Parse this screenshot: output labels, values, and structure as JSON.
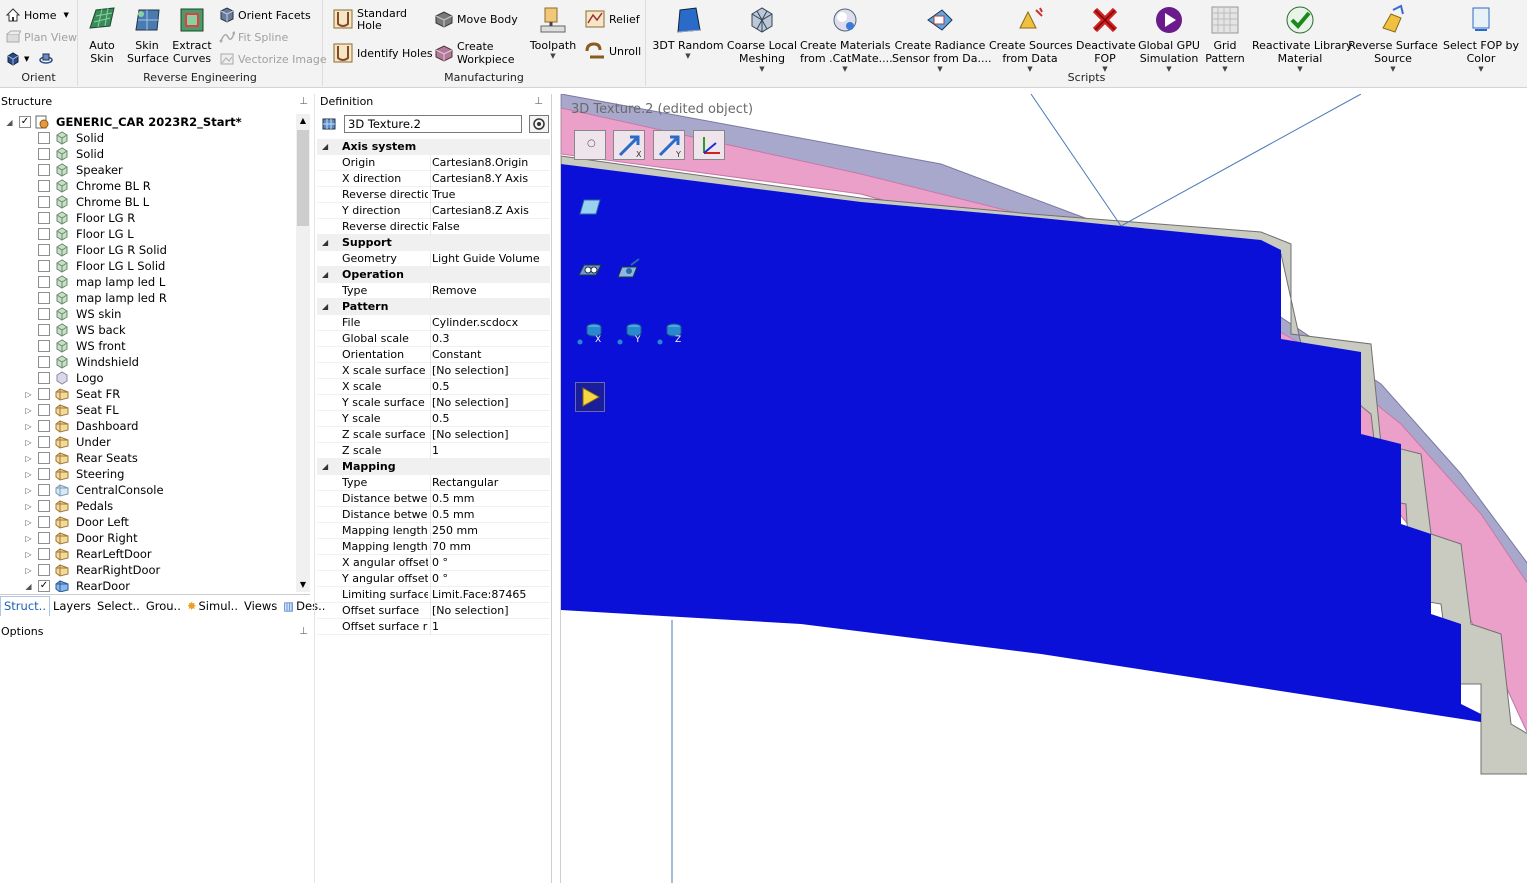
{
  "ribbon": {
    "orient": {
      "label": "Orient",
      "home": "Home",
      "plan_view": "Plan View"
    },
    "reverse_engineering": {
      "label": "Reverse Engineering",
      "auto_skin": "Auto\nSkin",
      "skin_surface": "Skin\nSurface",
      "extract_curves": "Extract\nCurves",
      "orient_facets": "Orient Facets",
      "fit_spline": "Fit Spline",
      "vectorize_image": "Vectorize Image"
    },
    "manufacturing": {
      "label": "Manufacturing",
      "standard_hole": "Standard\nHole",
      "identify_holes": "Identify Holes",
      "move_body": "Move Body",
      "create_workpiece": "Create\nWorkpiece",
      "toolpath": "Toolpath",
      "relief": "Relief",
      "unroll": "Unroll"
    },
    "scripts": {
      "label": "Scripts",
      "items": [
        {
          "label": "3DT Random",
          "icon": "3dt-random-icon"
        },
        {
          "label": "Coarse Local\nMeshing",
          "icon": "coarse-meshing-icon"
        },
        {
          "label": "Create Materials\nfrom .CatMate....",
          "icon": "create-materials-icon"
        },
        {
          "label": "Create Radiance\nSensor from Da....",
          "icon": "radiance-sensor-icon"
        },
        {
          "label": "Create Sources\nfrom Data",
          "icon": "create-sources-icon"
        },
        {
          "label": "Deactivate\nFOP",
          "icon": "deactivate-fop-icon"
        },
        {
          "label": "Global GPU\nSimulation",
          "icon": "gpu-simulation-icon"
        },
        {
          "label": "Grid\nPattern",
          "icon": "grid-pattern-icon"
        },
        {
          "label": "Reactivate Library\nMaterial",
          "icon": "reactivate-material-icon"
        },
        {
          "label": "Reverse Surface\nSource",
          "icon": "reverse-surface-icon"
        },
        {
          "label": "Select FOP by\nColor",
          "icon": "select-fop-icon"
        }
      ]
    }
  },
  "structure": {
    "title": "Structure",
    "root": "GENERIC_CAR 2023R2_Start*",
    "items": [
      {
        "label": "Solid",
        "expandable": false,
        "icon": "solid-body-icon"
      },
      {
        "label": "Solid",
        "expandable": false,
        "icon": "solid-body-icon"
      },
      {
        "label": "Speaker",
        "expandable": false,
        "icon": "solid-body-icon"
      },
      {
        "label": "Chrome BL R",
        "expandable": false,
        "icon": "solid-body-icon"
      },
      {
        "label": "Chrome BL L",
        "expandable": false,
        "icon": "solid-body-icon"
      },
      {
        "label": "Floor LG R",
        "expandable": false,
        "icon": "solid-body-icon"
      },
      {
        "label": "Floor LG L",
        "expandable": false,
        "icon": "solid-body-icon"
      },
      {
        "label": "Floor LG R Solid",
        "expandable": false,
        "icon": "solid-body-icon"
      },
      {
        "label": "Floor LG L Solid",
        "expandable": false,
        "icon": "solid-body-icon"
      },
      {
        "label": "map lamp led L",
        "expandable": false,
        "icon": "solid-body-icon"
      },
      {
        "label": "map lamp led R",
        "expandable": false,
        "icon": "solid-body-icon"
      },
      {
        "label": "WS skin",
        "expandable": false,
        "icon": "solid-body-icon"
      },
      {
        "label": "WS back",
        "expandable": false,
        "icon": "solid-body-icon"
      },
      {
        "label": "WS front",
        "expandable": false,
        "icon": "solid-body-icon"
      },
      {
        "label": "Windshield",
        "expandable": false,
        "icon": "solid-body-icon"
      },
      {
        "label": "Logo",
        "expandable": false,
        "icon": "surface-body-icon"
      },
      {
        "label": "Seat FR",
        "expandable": true,
        "icon": "component-icon"
      },
      {
        "label": "Seat FL",
        "expandable": true,
        "icon": "component-icon"
      },
      {
        "label": "Dashboard",
        "expandable": true,
        "icon": "component-icon"
      },
      {
        "label": "Under",
        "expandable": true,
        "icon": "component-icon"
      },
      {
        "label": "Rear Seats",
        "expandable": true,
        "icon": "component-icon"
      },
      {
        "label": "Steering",
        "expandable": true,
        "icon": "component-icon"
      },
      {
        "label": "CentralConsole",
        "expandable": true,
        "icon": "component-light-icon"
      },
      {
        "label": "Pedals",
        "expandable": true,
        "icon": "component-icon"
      },
      {
        "label": "Door Left",
        "expandable": true,
        "icon": "component-icon"
      },
      {
        "label": "Door Right",
        "expandable": true,
        "icon": "component-icon"
      },
      {
        "label": "RearLeftDoor",
        "expandable": true,
        "icon": "component-icon"
      },
      {
        "label": "RearRightDoor",
        "expandable": true,
        "icon": "component-icon"
      },
      {
        "label": "RearDoor",
        "expandable": true,
        "expanded": true,
        "checked": true,
        "icon": "component-blue-icon"
      }
    ],
    "tabs": [
      {
        "label": "Struct..",
        "active": true
      },
      {
        "label": "Layers"
      },
      {
        "label": "Select.."
      },
      {
        "label": "Grou.."
      },
      {
        "label": "Simul.."
      },
      {
        "label": "Views"
      },
      {
        "label": "Des.."
      }
    ]
  },
  "options": {
    "title": "Options"
  },
  "definition": {
    "title": "Definition",
    "name": "3D Texture.2",
    "categories": [
      {
        "name": "Axis system",
        "props": [
          [
            "Origin",
            "Cartesian8.Origin"
          ],
          [
            "X direction",
            "Cartesian8.Y Axis"
          ],
          [
            "Reverse direction",
            "True"
          ],
          [
            "Y direction",
            "Cartesian8.Z Axis"
          ],
          [
            "Reverse direction",
            "False"
          ]
        ]
      },
      {
        "name": "Support",
        "props": [
          [
            "Geometry",
            "Light Guide Volume"
          ]
        ]
      },
      {
        "name": "Operation",
        "props": [
          [
            "Type",
            "Remove"
          ]
        ]
      },
      {
        "name": "Pattern",
        "props": [
          [
            "File",
            "Cylinder.scdocx"
          ],
          [
            "Global scale",
            "0.3"
          ],
          [
            "Orientation",
            "Constant"
          ],
          [
            "X scale surface",
            "[No selection]"
          ],
          [
            "X scale",
            "0.5"
          ],
          [
            "Y scale surface",
            "[No selection]"
          ],
          [
            "Y scale",
            "0.5"
          ],
          [
            "Z scale surface",
            "[No selection]"
          ],
          [
            "Z scale",
            "1"
          ]
        ]
      },
      {
        "name": "Mapping",
        "props": [
          [
            "Type",
            "Rectangular"
          ],
          [
            "Distance between",
            "0.5 mm"
          ],
          [
            "Distance between",
            "0.5 mm"
          ],
          [
            "Mapping length al",
            "250 mm"
          ],
          [
            "Mapping length al",
            "70 mm"
          ],
          [
            "X angular offset",
            "0 °"
          ],
          [
            "Y angular offset",
            "0 °"
          ],
          [
            "Limiting surface",
            "Limit.Face:87465"
          ],
          [
            "Offset surface",
            "[No selection]"
          ],
          [
            "Offset surface rati",
            "1"
          ]
        ]
      }
    ]
  },
  "viewport": {
    "title": "3D Texture.2 (edited object)",
    "axis_labels": [
      "X",
      "Y",
      "Z"
    ],
    "colors": {
      "body": "#0a10d8",
      "pink": "#e8a0c4",
      "lavender": "#a0a0c8",
      "frame": "#c8cac0"
    }
  }
}
